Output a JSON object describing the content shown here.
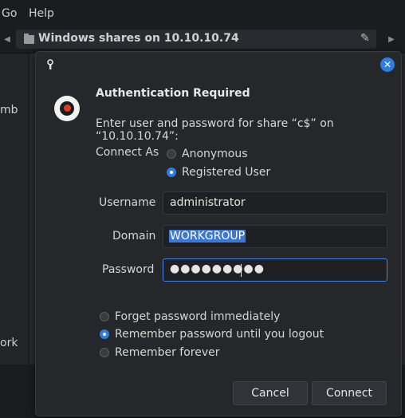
{
  "menubar": {
    "go": "Go",
    "help": "Help"
  },
  "pathbar": {
    "location": "Windows shares on 10.10.10.74"
  },
  "sidebar": {
    "item_mb": "mb",
    "item_ork": "ork"
  },
  "dialog": {
    "title": "Authentication Required",
    "message": "Enter user and password for share “c$” on “10.10.10.74”:",
    "connect_as_label": "Connect As",
    "options": {
      "anonymous": "Anonymous",
      "registered": "Registered User",
      "selected": "registered"
    },
    "username_label": "Username",
    "username_value": "administrator",
    "domain_label": "Domain",
    "domain_value": "WORKGROUP",
    "password_label": "Password",
    "password_value": "●●●●●●●●●",
    "remember": {
      "forget": "Forget password immediately",
      "logout": "Remember password until you logout",
      "forever": "Remember forever",
      "selected": "logout"
    },
    "cancel_label": "Cancel",
    "connect_label": "Connect"
  },
  "colors": {
    "accent": "#2e7de0",
    "background": "#26272b",
    "selection": "#3b78d8"
  }
}
